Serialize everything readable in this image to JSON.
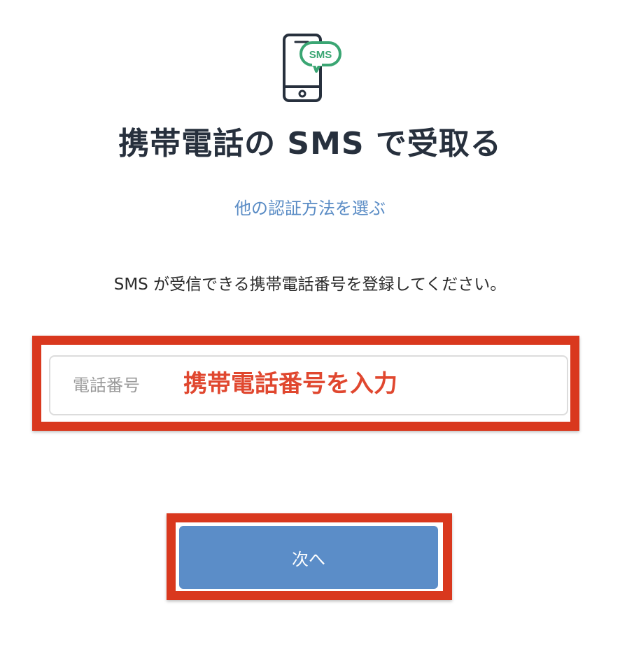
{
  "header": {
    "icon": "smartphone-sms-icon",
    "sms_badge": "SMS",
    "title": "携帯電話の SMS で受取る"
  },
  "alt_method_link": "他の認証方法を選ぶ",
  "instruction": "SMS が受信できる携帯電話番号を登録してください。",
  "phone_field": {
    "placeholder": "電話番号",
    "value": ""
  },
  "annotation": "携帯電話番号を入力",
  "next_button": "次へ",
  "colors": {
    "title": "#27303d",
    "link": "#5a8cc5",
    "button": "#5b8dc8",
    "highlight": "#d9381e",
    "sms_badge": "#3aa673"
  }
}
